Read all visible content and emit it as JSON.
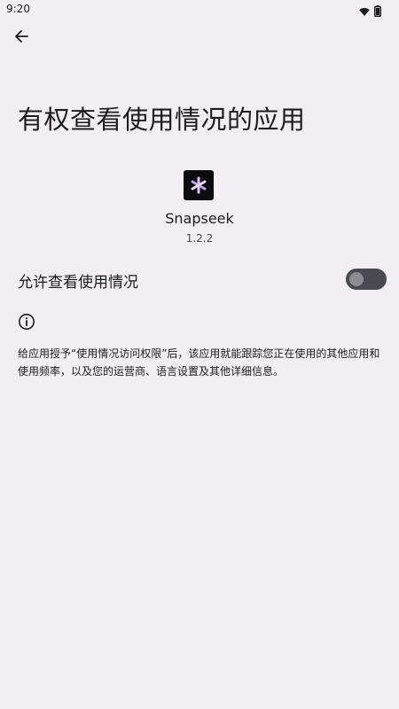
{
  "status_bar": {
    "time": "9:20",
    "wifi_icon": "wifi-icon",
    "battery_icon": "battery-icon"
  },
  "toolbar": {
    "back_icon": "arrow-back-icon"
  },
  "page": {
    "title": "有权查看使用情况的应用"
  },
  "app": {
    "icon": "snapseek-app-icon",
    "name": "Snapseek",
    "version": "1.2.2"
  },
  "permission_toggle": {
    "label": "允许查看使用情况",
    "enabled": false
  },
  "info": {
    "icon": "info-icon",
    "text": "给应用授予“使用情况访问权限”后，该应用就能跟踪您正在使用的其他应用和使用频率，以及您的运营商、语言设置及其他详细信息。"
  },
  "colors": {
    "background": "#f2eff4",
    "text": "#1c1b1f",
    "switch_track_off": "#4a4950",
    "switch_thumb_off": "#8e8b93"
  }
}
